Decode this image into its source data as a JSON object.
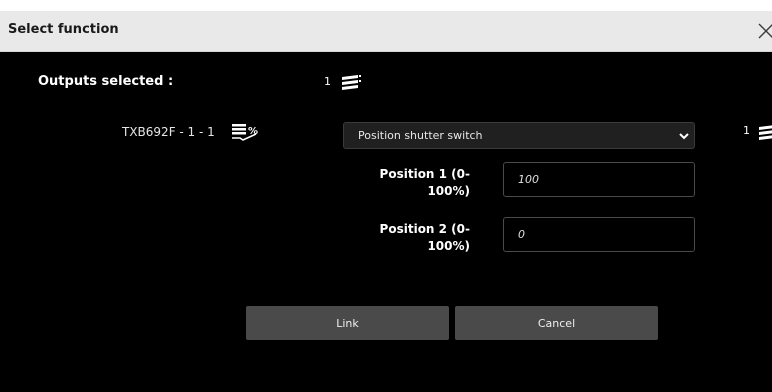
{
  "dialog": {
    "title": "Select function",
    "close_icon": "close-icon"
  },
  "outputs": {
    "label": "Outputs selected :",
    "count": "1",
    "icon": "stack-icon"
  },
  "device": {
    "name": "TXB692F - 1 - 1",
    "icon": "percent-shutter-icon"
  },
  "function_select": {
    "value": "Position shutter switch",
    "icon": "chevron-down-icon"
  },
  "right_count": {
    "count": "1",
    "icon": "stack-icon"
  },
  "position1": {
    "label_line1": "Position 1 (0-",
    "label_line2": "100%)",
    "value": "100"
  },
  "position2": {
    "label_line1": "Position 2 (0-",
    "label_line2": "100%)",
    "value": "0"
  },
  "buttons": {
    "link": "Link",
    "cancel": "Cancel"
  },
  "colors": {
    "background": "#000000",
    "titlebar": "#e9e9e9",
    "button": "#4a4a4a"
  }
}
